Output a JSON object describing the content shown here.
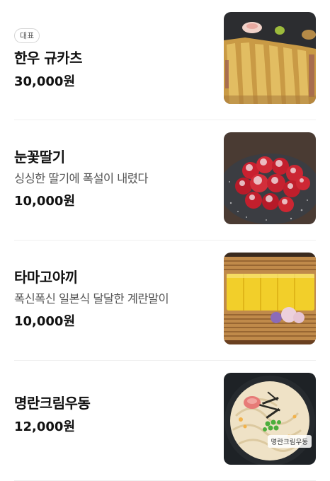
{
  "menu": {
    "items": [
      {
        "badge": "대표",
        "name": "한우 규카츠",
        "price": "30,000원",
        "image": "beef-cutlet-photo"
      },
      {
        "name": "눈꽃딸기",
        "description": "싱싱한 딸기에 폭설이 내렸다",
        "price": "10,000원",
        "image": "snow-strawberry-photo"
      },
      {
        "name": "타마고야끼",
        "description": "폭신폭신 일본식 달달한 계란말이",
        "price": "10,000원",
        "image": "tamagoyaki-photo"
      },
      {
        "name": "명란크림우동",
        "price": "12,000원",
        "image": "mentaiko-cream-udon-photo",
        "image_caption": "명란크림우동"
      }
    ]
  }
}
